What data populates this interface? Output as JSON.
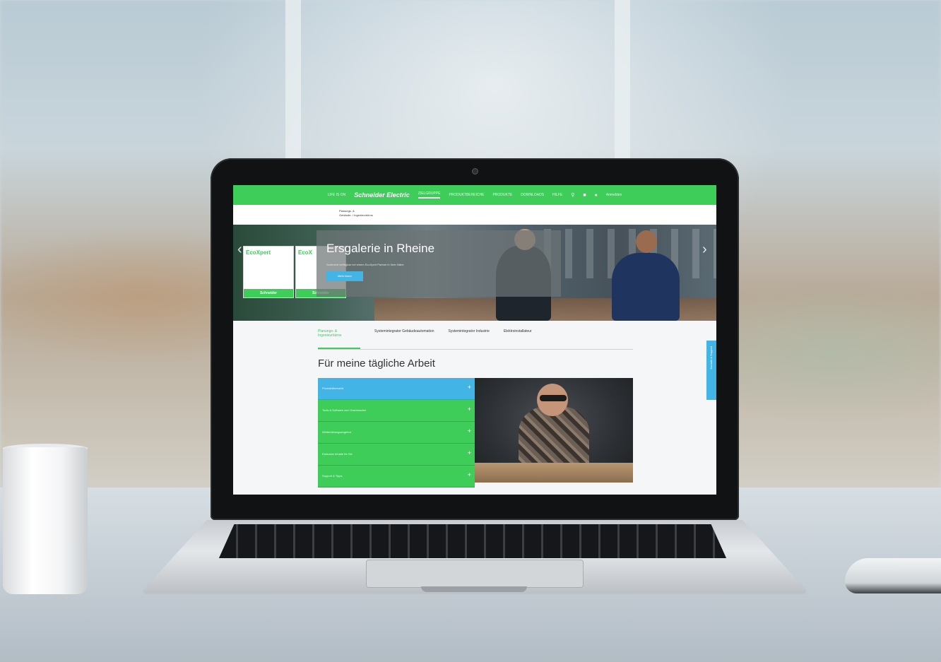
{
  "nav": {
    "items": [
      {
        "label": "LIFE IS ON"
      },
      {
        "label": "Schneider Electric",
        "is_logo": true
      },
      {
        "label": "ZIELGRUPPE",
        "active": true
      },
      {
        "label": "PRODUKTBEREICHE"
      },
      {
        "label": "PRODUKTE"
      },
      {
        "label": "DOWNLOADS"
      },
      {
        "label": "HILFE"
      }
    ],
    "icons": [
      "search-icon",
      "cart-icon",
      "user-icon"
    ],
    "account_label": "Anmelden"
  },
  "breadcrumb": {
    "line1": "Planungs- &",
    "line2": "Gebäude- / Ingenieurbüros"
  },
  "hero": {
    "title": "Ersgalerie in Rheine",
    "subtitle": "Sortiment verfügbar bei einem EcoXpert Partner in Ihrer Nähe",
    "button_label": "Mehr lesen",
    "panel_brand": "EcoXpert",
    "panel_brand_short": "EcoX",
    "panel_footer": "Schneider",
    "prev_arrow": "‹",
    "next_arrow": "›"
  },
  "tabs": [
    {
      "label": "Planungs- & Ingenieurbüros",
      "active": true
    },
    {
      "label": "Systemintegrator Gebäudeautomation"
    },
    {
      "label": "Systemintegrator Industrie"
    },
    {
      "label": "Elektroinstallateur"
    }
  ],
  "section_title": "Für meine tägliche Arbeit",
  "accordion": [
    {
      "label": "Produktübersicht",
      "active": true
    },
    {
      "label": "Tools & Software zum Downloaden"
    },
    {
      "label": "Weiterbildungsangebot"
    },
    {
      "label": "Exklusive Inhalte für Sie"
    },
    {
      "label": "Support & Tipps"
    }
  ],
  "side_tab_label": "Kontakt & Support",
  "colors": {
    "brand_green": "#3dcd58",
    "accent_blue": "#42b4e6"
  }
}
